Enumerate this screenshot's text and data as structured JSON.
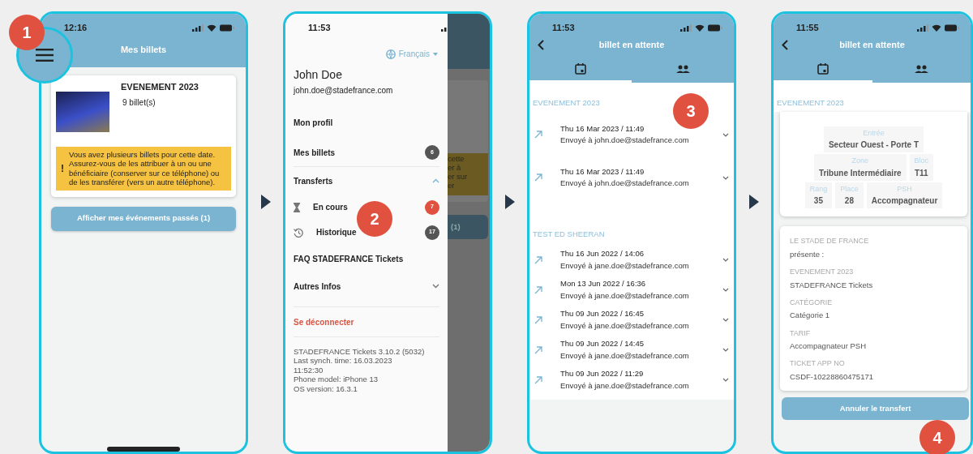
{
  "tickets_screen": {
    "step": "1",
    "time": "12:16",
    "title": "Mes billets",
    "event": {
      "name": "EVENEMENT 2023",
      "count": "9 billet(s)"
    },
    "notice_mark": "!",
    "notice": "Vous avez plusieurs billets pour cette date. Assurez-vous de les attribuer à un ou une bénéficiaire (conserver sur ce téléphone) ou de les transférer (vers un autre téléphone).",
    "past_button": "Afficher mes événements passés (1)"
  },
  "menu_screen": {
    "step": "2",
    "time": "11:53",
    "language": "Français",
    "user_name": "John Doe",
    "email": "john.doe@stadefrance.com",
    "items": [
      {
        "kind": "link",
        "label": "Mon profil"
      },
      {
        "kind": "link",
        "label": "Mes billets",
        "count": "6",
        "color": "#555555"
      },
      {
        "kind": "group",
        "label": "Transferts",
        "expanded": true,
        "children": [
          {
            "label": "En cours",
            "count": "7",
            "color": "#e0513f"
          },
          {
            "label": "Historique",
            "count": "17",
            "color": "#555555"
          }
        ]
      },
      {
        "kind": "link",
        "label": "FAQ STADEFRANCE Tickets"
      },
      {
        "kind": "group",
        "label": "Autres Infos",
        "expanded": false
      },
      {
        "kind": "logout",
        "label": "Se déconnecter"
      }
    ],
    "info_lines": [
      "STADEFRANCE Tickets 3.10.2 (5032)",
      "Last synch. time: 16.03.2023",
      "11:52:30",
      "Phone model: iPhone 13",
      "OS version: 16.3.1"
    ],
    "behind": {
      "notice_lines": [
        "cette",
        "er à",
        "er sur",
        "er"
      ],
      "button": "(1)"
    }
  },
  "transfers_screen": {
    "step": "3",
    "time": "11:53",
    "title": "billet en attente",
    "tabs": [
      {
        "selected": true
      },
      {
        "selected": false
      }
    ],
    "groups": [
      {
        "name": "EVENEMENT 2023",
        "transfers": [
          {
            "date": "Thu 16 Mar 2023 / 11:49",
            "recipient": "Envoyé à john.doe@stadefrance.com"
          },
          {
            "date": "Thu 16 Mar 2023 / 11:49",
            "recipient": "Envoyé à john.doe@stadefrance.com"
          }
        ]
      },
      {
        "name": "TEST ED SHEERAN",
        "transfers": [
          {
            "date": "Thu 16 Jun 2022 / 14:06",
            "recipient": "Envoyé à jane.doe@stadefrance.com"
          },
          {
            "date": "Mon 13 Jun 2022 / 16:36",
            "recipient": "Envoyé à jane.doe@stadefrance.com"
          },
          {
            "date": "Thu 09 Jun 2022 / 16:45",
            "recipient": "Envoyé à jane.doe@stadefrance.com"
          },
          {
            "date": "Thu 09 Jun 2022 / 14:45",
            "recipient": "Envoyé à jane.doe@stadefrance.com"
          },
          {
            "date": "Thu 09 Jun 2022 / 11:29",
            "recipient": "Envoyé à jane.doe@stadefrance.com"
          }
        ]
      }
    ]
  },
  "ticket_screen": {
    "step": "4",
    "time": "11:55",
    "title": "billet en attente",
    "tabs": [
      {
        "selected": true
      },
      {
        "selected": false
      }
    ],
    "event": "EVENEMENT 2023",
    "seat_rows": [
      [
        {
          "label": "Entrée",
          "value": "Secteur Ouest - Porte T"
        }
      ],
      [
        {
          "label": "Zone",
          "value": "Tribune Intermédiaire"
        },
        {
          "label": "Bloc",
          "value": "T11"
        }
      ],
      [
        {
          "label": "Rang",
          "value": "35"
        },
        {
          "label": "Place",
          "value": "28"
        },
        {
          "label": "PSH",
          "value": "Accompagnateur"
        }
      ]
    ],
    "info": [
      {
        "label": "LE STADE DE FRANCE",
        "value": "présente :"
      },
      {
        "label": "EVENEMENT 2023",
        "value": "STADEFRANCE Tickets"
      },
      {
        "label": "CATÉGORIE",
        "value": "Catégorie 1"
      },
      {
        "label": "TARIF",
        "value": "Accompagnateur PSH"
      },
      {
        "label": "TICKET APP NO",
        "value": "CSDF-10228860475171"
      }
    ],
    "cancel_button": "Annuler le transfert"
  }
}
